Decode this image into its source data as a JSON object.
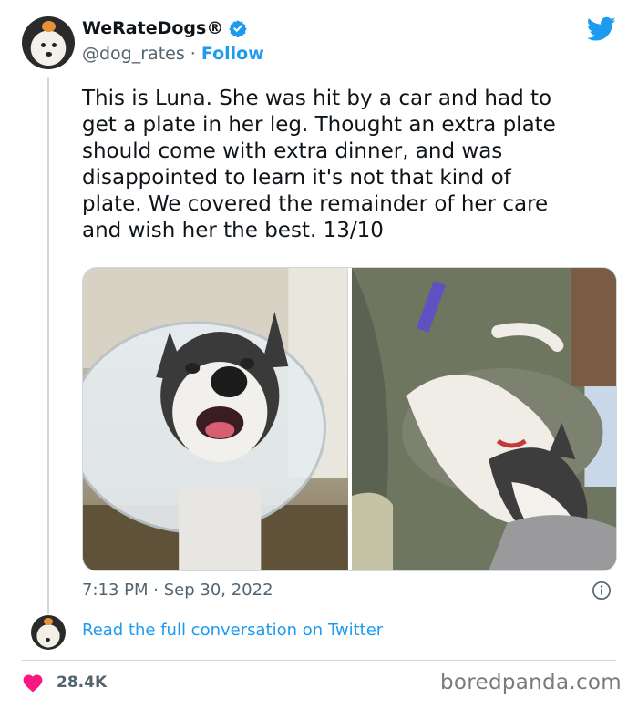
{
  "header": {
    "display_name": "WeRateDogs®",
    "handle": "@dog_rates",
    "separator": "·",
    "follow_label": "Follow"
  },
  "tweet": {
    "text": "This is Luna. She was hit by a car and had to\nget a plate in her leg. Thought an extra plate\nshould come with extra dinner, and was\ndisappointed to learn it's not that kind of\nplate. We covered the remainder of her care\nand wish her the best. 13/10",
    "time": "7:13 PM",
    "date_separator": "·",
    "date": "Sep 30, 2022"
  },
  "footer": {
    "read_link": "Read the full conversation on Twitter",
    "likes": "28.4K",
    "watermark": "boredpanda.com"
  },
  "colors": {
    "accent": "#1d9bf0",
    "like": "#f91880",
    "muted": "#536471"
  },
  "icons": [
    "verified-badge-icon",
    "twitter-bird-icon",
    "info-icon",
    "heart-icon"
  ]
}
